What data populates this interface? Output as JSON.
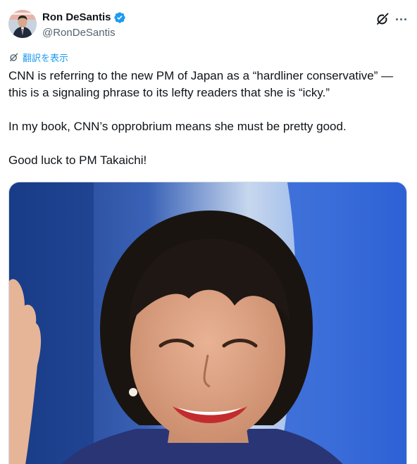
{
  "author": {
    "display_name": "Ron DeSantis",
    "handle": "@RonDeSantis",
    "verified": true
  },
  "translate_label": "翻訳を表示",
  "tweet": {
    "paragraphs": [
      "CNN is referring to the new PM of Japan as a “hardliner conservative” — this is a signaling phrase to its lefty readers that she is “icky.”",
      "In my book, CNN’s opprobrium means she must be pretty good.",
      "Good luck to PM Takaichi!"
    ]
  },
  "icons": {
    "verified": "verified-badge-icon",
    "grok": "grok-icon",
    "more": "more-icon",
    "translate": "translate-icon"
  },
  "colors": {
    "accent": "#1d9bf0",
    "text": "#0f1419",
    "secondary": "#536471"
  }
}
